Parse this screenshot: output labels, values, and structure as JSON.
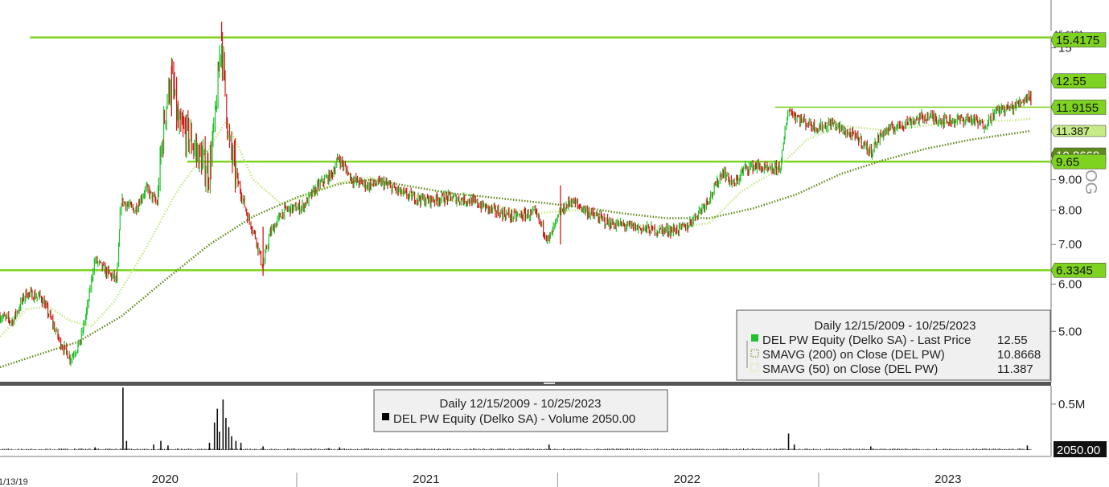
{
  "chart_data": [
    {
      "type": "line",
      "panel": "price",
      "scale": "log",
      "ylim": [
        4.1,
        17.5
      ],
      "x_range": [
        "2019-11-13",
        "2023-11-20"
      ],
      "axis_side_label": "LOG",
      "y_ticks": [
        {
          "value": 5,
          "label": "5.00"
        },
        {
          "value": 6,
          "label": "6.00"
        },
        {
          "value": 7,
          "label": "7.00"
        },
        {
          "value": 8,
          "label": "8.00"
        },
        {
          "value": 9,
          "label": "9.00"
        },
        {
          "value": 10,
          "label": "10"
        },
        {
          "value": 15,
          "label": "15"
        }
      ],
      "legend": {
        "title": "Daily 12/15/2009 - 10/25/2023",
        "entries": [
          {
            "label": "DEL PW Equity (Delko SA) - Last Price",
            "value": "12.55",
            "color": "#22c22e",
            "marker": "solid"
          },
          {
            "label": "SMAVG (200)  on Close (DEL PW)",
            "value": "10.8668",
            "color": "#5f8a1a",
            "marker": "dotted"
          },
          {
            "label": "SMAVG (50)  on Close (DEL PW)",
            "value": "11.387",
            "color": "#c6ea88",
            "marker": "dotted"
          }
        ]
      },
      "series": [
        {
          "name": "DEL PW Equity (Delko SA) - Last Price",
          "style": "candles",
          "color_up": "#22c22e",
          "color_down": "#d41a1a",
          "points": [
            [
              "2019-11-13",
              5.3
            ],
            [
              "2019-12-01",
              5.2
            ],
            [
              "2019-12-20",
              5.8
            ],
            [
              "2020-01-10",
              5.7
            ],
            [
              "2020-01-25",
              5.2
            ],
            [
              "2020-02-05",
              4.8
            ],
            [
              "2020-02-20",
              4.5
            ],
            [
              "2020-03-05",
              4.8
            ],
            [
              "2020-03-15",
              5.5
            ],
            [
              "2020-03-25",
              6.6
            ],
            [
              "2020-04-10",
              6.3
            ],
            [
              "2020-04-25",
              6.1
            ],
            [
              "2020-05-01",
              8.3
            ],
            [
              "2020-05-20",
              8.0
            ],
            [
              "2020-06-05",
              8.7
            ],
            [
              "2020-06-20",
              8.2
            ],
            [
              "2020-07-01",
              11.5
            ],
            [
              "2020-07-10",
              13.5
            ],
            [
              "2020-07-20",
              11.0
            ],
            [
              "2020-08-01",
              10.8
            ],
            [
              "2020-08-15",
              10.0
            ],
            [
              "2020-09-01",
              9.3
            ],
            [
              "2020-09-10",
              11.5
            ],
            [
              "2020-09-18",
              15.5
            ],
            [
              "2020-09-28",
              10.5
            ],
            [
              "2020-10-10",
              9.0
            ],
            [
              "2020-10-25",
              7.8
            ],
            [
              "2020-11-05",
              7.2
            ],
            [
              "2020-11-15",
              6.4
            ],
            [
              "2020-11-25",
              7.3
            ],
            [
              "2020-12-15",
              8.0
            ],
            [
              "2021-01-10",
              8.1
            ],
            [
              "2021-02-01",
              8.8
            ],
            [
              "2021-02-20",
              9.2
            ],
            [
              "2021-03-01",
              9.8
            ],
            [
              "2021-03-20",
              9.0
            ],
            [
              "2021-04-10",
              8.8
            ],
            [
              "2021-05-01",
              8.9
            ],
            [
              "2021-06-01",
              8.5
            ],
            [
              "2021-07-01",
              8.3
            ],
            [
              "2021-08-01",
              8.4
            ],
            [
              "2021-09-01",
              8.3
            ],
            [
              "2021-10-01",
              8.0
            ],
            [
              "2021-11-01",
              7.8
            ],
            [
              "2021-12-01",
              7.9
            ],
            [
              "2021-12-20",
              7.1
            ],
            [
              "2022-01-05",
              7.9
            ],
            [
              "2022-01-20",
              8.3
            ],
            [
              "2022-02-15",
              7.9
            ],
            [
              "2022-03-15",
              7.6
            ],
            [
              "2022-04-15",
              7.5
            ],
            [
              "2022-05-15",
              7.4
            ],
            [
              "2022-06-15",
              7.4
            ],
            [
              "2022-07-01",
              7.5
            ],
            [
              "2022-07-20",
              8.0
            ],
            [
              "2022-08-05",
              8.5
            ],
            [
              "2022-08-20",
              9.3
            ],
            [
              "2022-09-05",
              8.8
            ],
            [
              "2022-09-20",
              9.4
            ],
            [
              "2022-10-05",
              9.5
            ],
            [
              "2022-10-25",
              9.3
            ],
            [
              "2022-11-10",
              9.5
            ],
            [
              "2022-11-20",
              11.8
            ],
            [
              "2022-12-10",
              11.3
            ],
            [
              "2023-01-01",
              11.0
            ],
            [
              "2023-01-20",
              11.2
            ],
            [
              "2023-02-10",
              10.8
            ],
            [
              "2023-03-01",
              10.5
            ],
            [
              "2023-03-15",
              10.0
            ],
            [
              "2023-04-01",
              10.8
            ],
            [
              "2023-05-01",
              11.2
            ],
            [
              "2023-06-01",
              11.5
            ],
            [
              "2023-07-01",
              11.3
            ],
            [
              "2023-08-01",
              11.4
            ],
            [
              "2023-08-20",
              11.1
            ],
            [
              "2023-09-10",
              11.8
            ],
            [
              "2023-10-01",
              11.9
            ],
            [
              "2023-10-25",
              12.55
            ]
          ]
        },
        {
          "name": "SMAVG (200)  on Close (DEL PW)",
          "style": "dotted",
          "color": "#5f8a1a",
          "points": [
            [
              "2019-11-13",
              4.35
            ],
            [
              "2020-01-01",
              4.55
            ],
            [
              "2020-03-01",
              4.8
            ],
            [
              "2020-05-01",
              5.3
            ],
            [
              "2020-07-01",
              6.1
            ],
            [
              "2020-09-01",
              7.0
            ],
            [
              "2020-11-01",
              7.8
            ],
            [
              "2021-01-01",
              8.4
            ],
            [
              "2021-03-01",
              8.85
            ],
            [
              "2021-04-15",
              9.0
            ],
            [
              "2021-06-01",
              8.8
            ],
            [
              "2021-08-01",
              8.55
            ],
            [
              "2021-10-01",
              8.4
            ],
            [
              "2021-12-01",
              8.25
            ],
            [
              "2022-02-01",
              8.1
            ],
            [
              "2022-04-01",
              7.9
            ],
            [
              "2022-06-01",
              7.75
            ],
            [
              "2022-08-01",
              7.75
            ],
            [
              "2022-10-01",
              8.05
            ],
            [
              "2022-12-01",
              8.5
            ],
            [
              "2023-02-01",
              9.2
            ],
            [
              "2023-04-01",
              9.7
            ],
            [
              "2023-06-01",
              10.15
            ],
            [
              "2023-08-01",
              10.5
            ],
            [
              "2023-10-25",
              10.87
            ]
          ]
        },
        {
          "name": "SMAVG (50)  on Close (DEL PW)",
          "style": "dotted",
          "color": "#c6ea88",
          "points": [
            [
              "2019-11-13",
              4.9
            ],
            [
              "2019-12-20",
              5.45
            ],
            [
              "2020-01-20",
              5.5
            ],
            [
              "2020-02-20",
              5.2
            ],
            [
              "2020-03-20",
              5.1
            ],
            [
              "2020-04-20",
              5.6
            ],
            [
              "2020-06-01",
              6.8
            ],
            [
              "2020-07-20",
              8.7
            ],
            [
              "2020-09-01",
              10.2
            ],
            [
              "2020-09-25",
              11.3
            ],
            [
              "2020-11-01",
              9.0
            ],
            [
              "2020-12-10",
              8.2
            ],
            [
              "2021-01-20",
              8.5
            ],
            [
              "2021-03-01",
              8.9
            ],
            [
              "2021-04-15",
              9.1
            ],
            [
              "2021-06-01",
              8.5
            ],
            [
              "2021-08-01",
              8.3
            ],
            [
              "2021-10-01",
              8.15
            ],
            [
              "2021-12-01",
              7.9
            ],
            [
              "2022-02-01",
              8.0
            ],
            [
              "2022-04-01",
              7.6
            ],
            [
              "2022-06-01",
              7.45
            ],
            [
              "2022-08-01",
              7.6
            ],
            [
              "2022-09-15",
              8.6
            ],
            [
              "2022-11-01",
              9.3
            ],
            [
              "2022-12-15",
              10.5
            ],
            [
              "2023-02-01",
              11.1
            ],
            [
              "2023-04-01",
              10.9
            ],
            [
              "2023-06-01",
              11.1
            ],
            [
              "2023-08-01",
              11.35
            ],
            [
              "2023-09-15",
              11.3
            ],
            [
              "2023-10-25",
              11.387
            ]
          ]
        }
      ],
      "horizontal_lines": [
        {
          "value": 15.6121,
          "x_start": "2019-12-25",
          "label": "15.6121"
        },
        {
          "value": 9.65,
          "x_start": "2020-08-01",
          "label": "9.65"
        },
        {
          "value": 6.3345,
          "x_start": "2019-11-13",
          "label": "6.3345"
        },
        {
          "value": 11.9155,
          "x_start": "2022-11-01",
          "label": "11.9155"
        }
      ],
      "price_labels": [
        {
          "value": 15.6121,
          "label": "15.6121",
          "style": "small"
        },
        {
          "value": 15.6121,
          "label": "15.4175",
          "style": "bright"
        },
        {
          "value": 12.55,
          "label": "12.55",
          "style": "bright"
        },
        {
          "value": 11.9155,
          "label": "11.9155",
          "style": "bright"
        },
        {
          "value": 11.387,
          "label": "11.387",
          "style": "pale"
        },
        {
          "value": 10.8668,
          "label": "10.8668",
          "style": "dark"
        },
        {
          "value": 9.65,
          "label": "9.65",
          "style": "bright"
        },
        {
          "value": 6.3345,
          "label": "6.3345",
          "style": "bright"
        }
      ]
    },
    {
      "type": "bar",
      "panel": "volume",
      "ylim": [
        0,
        0.7
      ],
      "unit": "M",
      "y_ticks": [
        {
          "value": 0.5,
          "label": "0.5M"
        }
      ],
      "legend": {
        "title": "Daily 12/15/2009 - 10/25/2023",
        "entries": [
          {
            "label": "DEL PW Equity (Delko SA) - Volume",
            "value": "2050.00",
            "color": "#000000"
          }
        ]
      },
      "last_value_label": "2050.00",
      "series": [
        {
          "name": "DEL PW Equity (Delko SA) - Volume",
          "points": [
            [
              "2020-03-25",
              0.03
            ],
            [
              "2020-05-03",
              0.68
            ],
            [
              "2020-05-08",
              0.1
            ],
            [
              "2020-06-15",
              0.06
            ],
            [
              "2020-06-25",
              0.1
            ],
            [
              "2020-07-05",
              0.05
            ],
            [
              "2020-09-01",
              0.08
            ],
            [
              "2020-09-08",
              0.3
            ],
            [
              "2020-09-12",
              0.45
            ],
            [
              "2020-09-15",
              0.2
            ],
            [
              "2020-09-20",
              0.55
            ],
            [
              "2020-09-24",
              0.35
            ],
            [
              "2020-09-28",
              0.25
            ],
            [
              "2020-10-02",
              0.15
            ],
            [
              "2020-10-08",
              0.1
            ],
            [
              "2020-10-15",
              0.08
            ],
            [
              "2020-11-15",
              0.04
            ],
            [
              "2021-02-15",
              0.02
            ],
            [
              "2021-03-02",
              0.03
            ],
            [
              "2021-12-20",
              0.06
            ],
            [
              "2022-11-20",
              0.18
            ],
            [
              "2022-11-28",
              0.06
            ],
            [
              "2023-03-15",
              0.04
            ],
            [
              "2023-10-20",
              0.05
            ]
          ]
        }
      ]
    }
  ],
  "x_axis": {
    "start_date_label": "1/13/19",
    "ticks": [
      {
        "date": "2020-07-01",
        "label": "2020"
      },
      {
        "date": "2021-07-01",
        "label": "2021"
      },
      {
        "date": "2022-07-01",
        "label": "2022"
      },
      {
        "date": "2023-07-01",
        "label": "2023"
      }
    ],
    "separators": [
      "2021-01-01",
      "2022-01-01",
      "2023-01-01"
    ]
  }
}
